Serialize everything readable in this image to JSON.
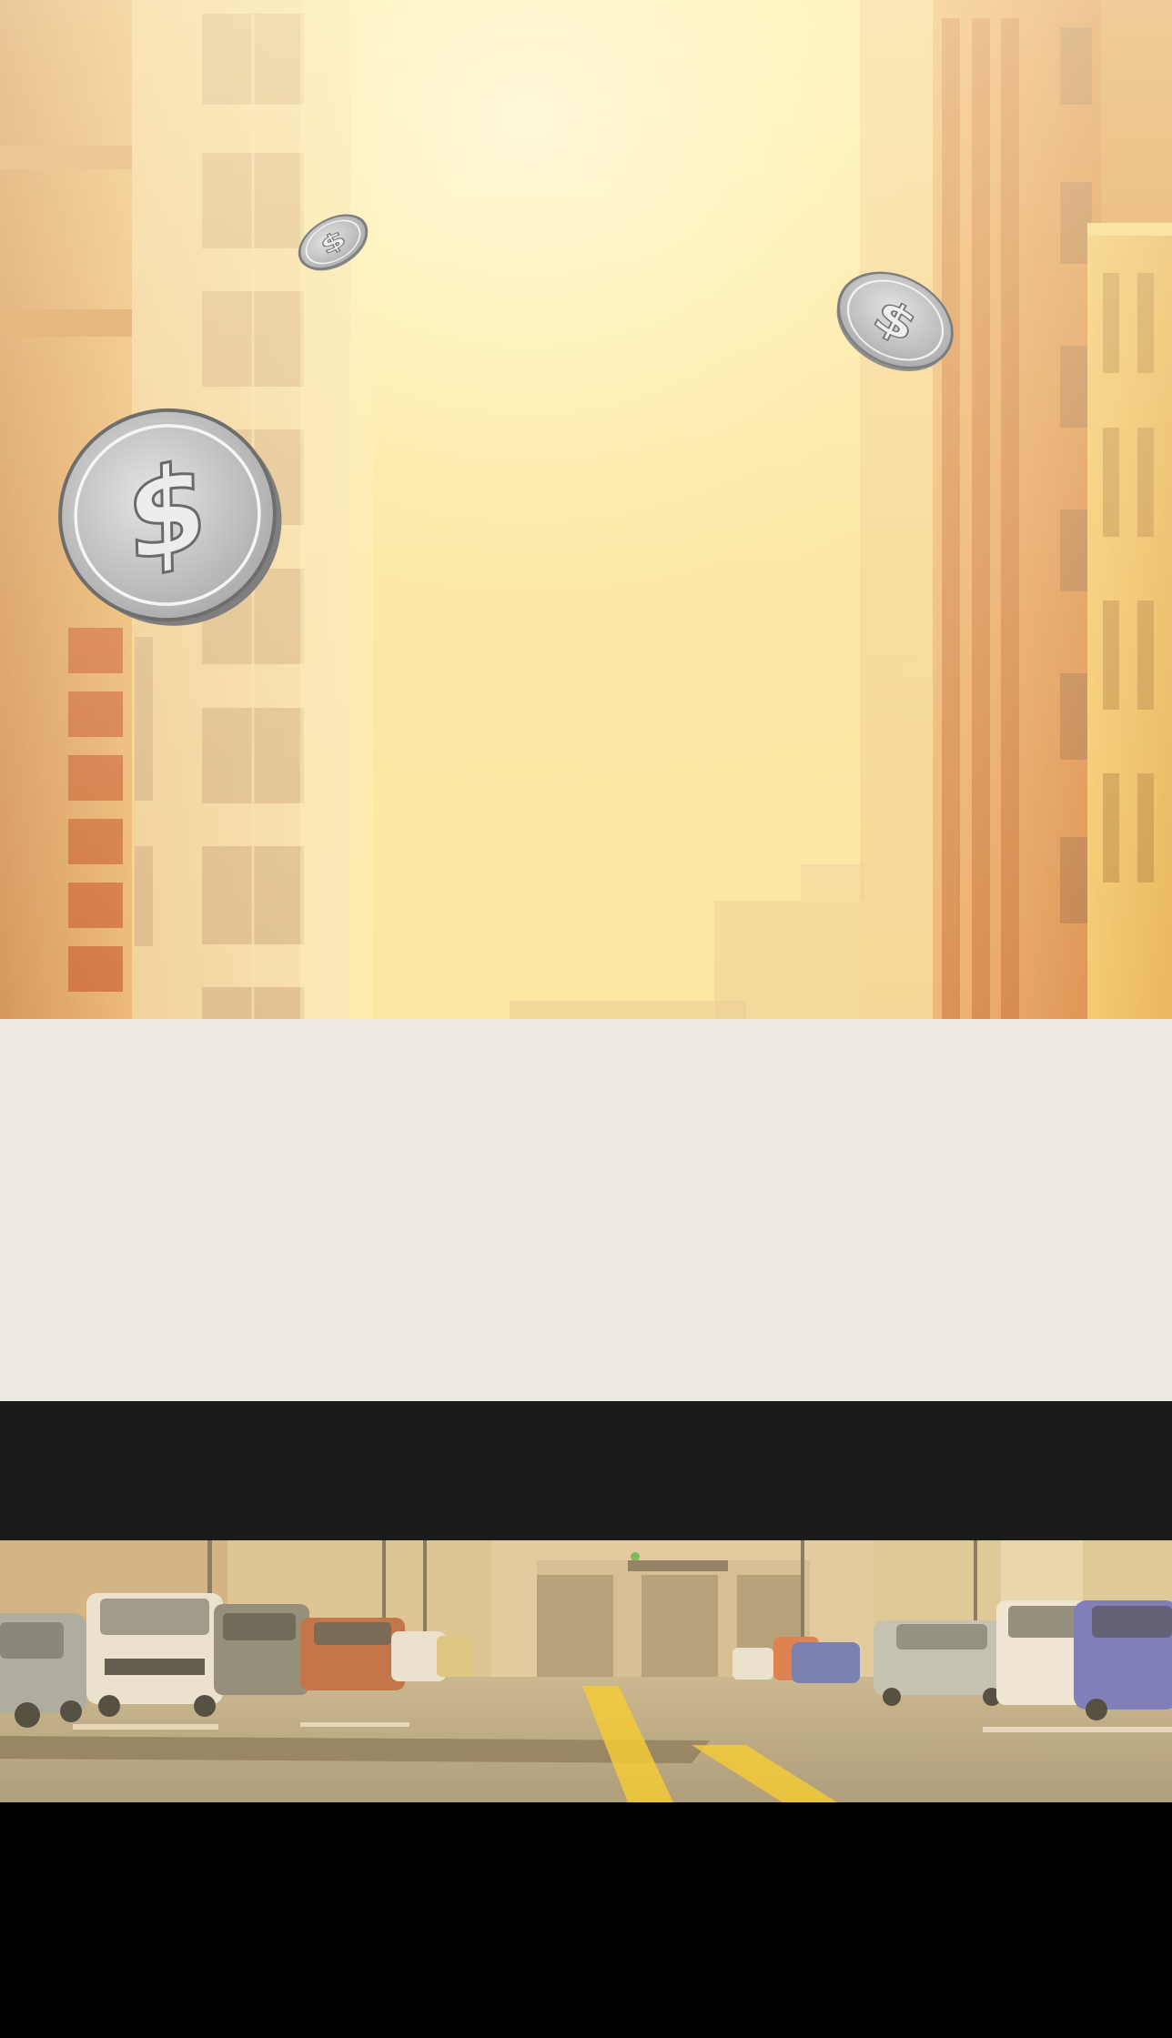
{
  "colors": {
    "sky_glow": "#fff6c8",
    "building_warm": "#e3a15f",
    "building_pale": "#f0c98a",
    "panel_background": "#edeae4",
    "dark_bar": "#1b1b1b",
    "page_background": "#000000",
    "coin_silver": "#c9c9c9",
    "road_yellow_line": "#f2c51c"
  },
  "scene": {
    "background": "city-street-sunset",
    "coins": [
      {
        "icon": "dollar-coin-icon",
        "symbol": "$"
      },
      {
        "icon": "dollar-coin-icon",
        "symbol": "$"
      },
      {
        "icon": "dollar-coin-icon",
        "symbol": "$"
      }
    ],
    "street": "city-street-traffic"
  }
}
